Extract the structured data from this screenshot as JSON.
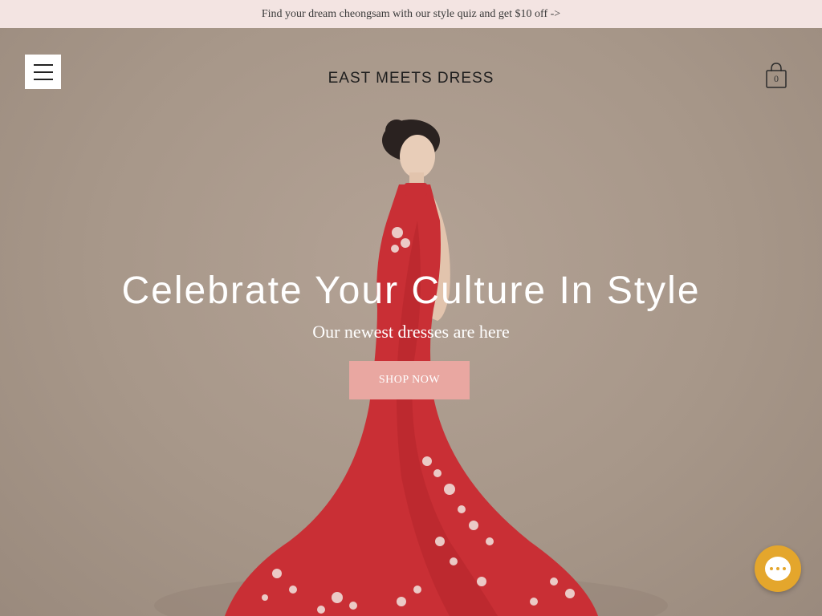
{
  "announcement": {
    "text": "Find your dream cheongsam with our style quiz and get $10 off ->"
  },
  "header": {
    "logo_text": "EAST MEETS DRESS",
    "cart_count": "0",
    "menu_icon": "hamburger-menu-icon",
    "cart_icon": "shopping-bag-icon"
  },
  "hero": {
    "title": "Celebrate Your Culture In Style",
    "subtitle": "Our newest dresses are here",
    "cta_label": "SHOP NOW"
  },
  "chat": {
    "icon": "chat-bubble-icon"
  },
  "colors": {
    "announcement_bg": "#f3e4e2",
    "hero_bg": "#a79789",
    "cta_bg": "#e9a7a1",
    "dress_red": "#d8333a",
    "chat_accent": "#e4a62c"
  }
}
